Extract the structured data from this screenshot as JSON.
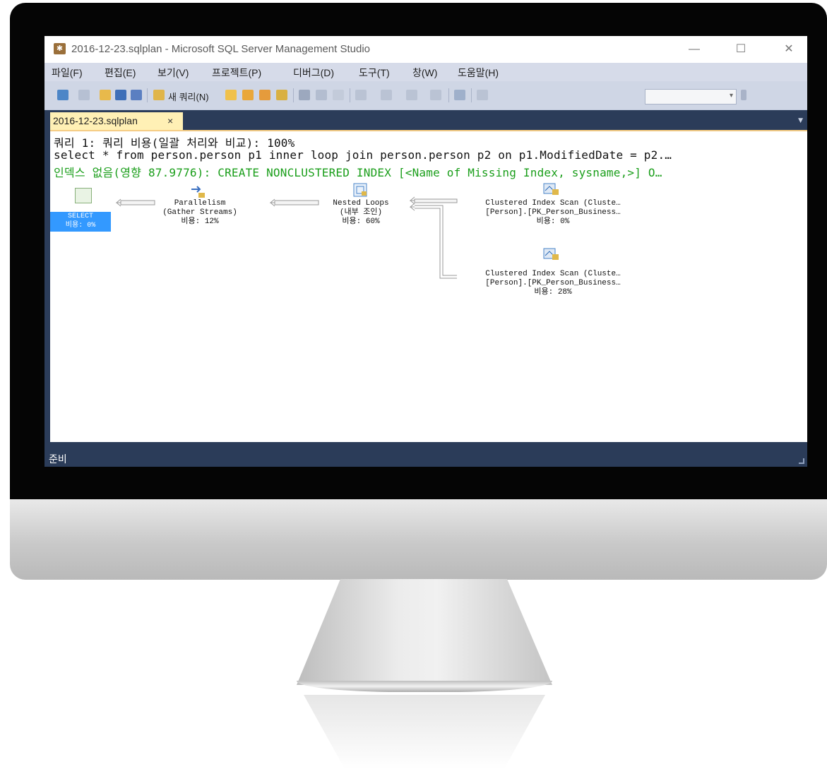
{
  "window": {
    "title": "2016-12-23.sqlplan - Microsoft SQL Server Management Studio",
    "minimize_symbol": "—",
    "maximize_symbol": "☐",
    "close_symbol": "✕"
  },
  "menu": {
    "items": [
      "파일(F)",
      "편집(E)",
      "보기(V)",
      "프로젝트(P)",
      "디버그(D)",
      "도구(T)",
      "창(W)",
      "도움말(H)"
    ]
  },
  "toolbar": {
    "new_query_label": "새 쿼리(N)",
    "combo_value": ""
  },
  "tab": {
    "label": "2016-12-23.sqlplan",
    "close_symbol": "×"
  },
  "query": {
    "header": "쿼리 1: 쿼리 비용(일괄 처리와 비교): 100%",
    "sql": "select * from person.person p1 inner loop join person.person p2 on p1.ModifiedDate = p2.…",
    "missing_index": "인덱스 없음(영향 87.9776): CREATE NONCLUSTERED INDEX [<Name of Missing Index, sysname,>] O…"
  },
  "plan": {
    "select": {
      "line1": "SELECT",
      "line2": "비용: 0%"
    },
    "parallelism": {
      "line1": "Parallelism",
      "line2": "(Gather Streams)",
      "line3": "비용: 12%"
    },
    "nested_loops": {
      "line1": "Nested Loops",
      "line2": "(내부 조인)",
      "line3": "비용: 60%"
    },
    "scan1": {
      "line1": "Clustered Index Scan (Cluste…",
      "line2": "[Person].[PK_Person_Business…",
      "line3": "비용: 0%"
    },
    "scan2": {
      "line1": "Clustered Index Scan (Cluste…",
      "line2": "[Person].[PK_Person_Business…",
      "line3": "비용: 28%"
    }
  },
  "status": {
    "text": "준비"
  },
  "colors": {
    "chrome_dark": "#2b3c59",
    "menu_bg": "#d6dbe9",
    "toolbar_bg": "#cfd6e5",
    "tab_active": "#fff0b5",
    "selection": "#3399ff",
    "missing_index_text": "#1a9e1a"
  }
}
